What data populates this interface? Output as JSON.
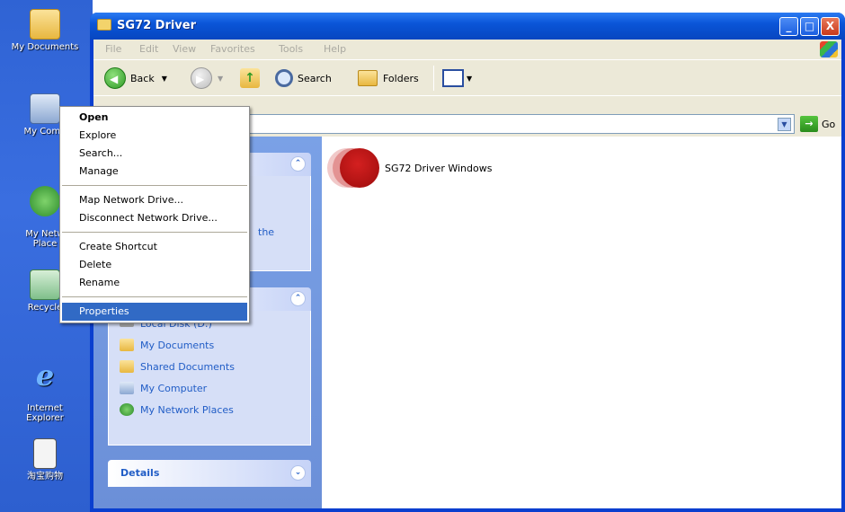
{
  "desktop": {
    "icons": [
      {
        "label": "My Documents"
      },
      {
        "label": "My Comp"
      },
      {
        "label": "My Netw\nPlace"
      },
      {
        "label": "Recycle"
      },
      {
        "label": "Internet\nExplorer"
      },
      {
        "label": "淘宝购物"
      }
    ]
  },
  "window": {
    "title": "SG72 Driver",
    "buttons": {
      "minimize": "_",
      "maximize": "□",
      "close": "X"
    }
  },
  "menubar": {
    "items": [
      "File",
      "Edit",
      "View",
      "Favorites",
      "Tools",
      "Help"
    ]
  },
  "toolbar": {
    "back": "Back",
    "search": "Search",
    "folders": "Folders"
  },
  "address": {
    "go": "Go"
  },
  "taskpane": {
    "partial_text": "the",
    "other_places": [
      {
        "label": "Local Disk (D:)",
        "icon": "disk-icon"
      },
      {
        "label": "My Documents",
        "icon": "folder-docs-icon"
      },
      {
        "label": "Shared Documents",
        "icon": "folder-icon"
      },
      {
        "label": "My Computer",
        "icon": "computer-icon"
      },
      {
        "label": "My Network Places",
        "icon": "network-icon"
      }
    ],
    "details_label": "Details"
  },
  "content": {
    "file_name": "SG72 Driver Windows"
  },
  "context_menu": {
    "items": [
      "Open",
      "Explore",
      "Search...",
      "Manage",
      "Map Network Drive...",
      "Disconnect Network Drive...",
      "Create Shortcut",
      "Delete",
      "Rename",
      "Properties"
    ],
    "selected": "Properties"
  },
  "colors": {
    "titlebar": "#0a55d8",
    "selection": "#316ac5",
    "taskpane_link": "#215dc6",
    "file_icon": "#b51111"
  }
}
